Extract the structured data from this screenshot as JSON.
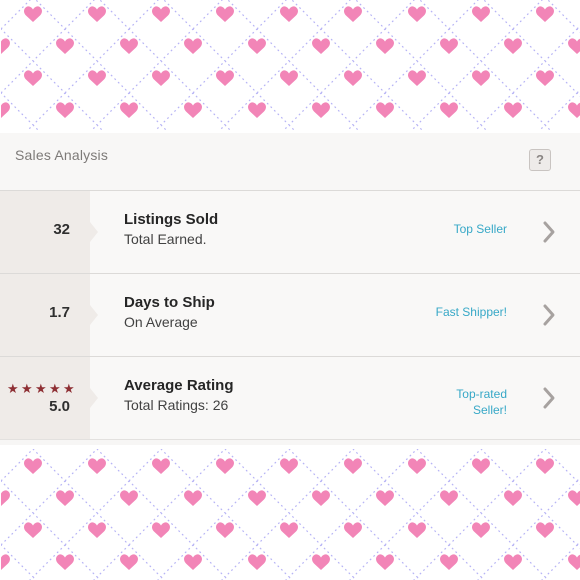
{
  "panel": {
    "title": "Sales Analysis",
    "help_label": "?"
  },
  "stats": [
    {
      "value": "32",
      "title": "Listings Sold",
      "subtitle": "Total Earned.",
      "badge": "Top Seller"
    },
    {
      "value": "1.7",
      "title": "Days to Ship",
      "subtitle": "On Average",
      "badge": "Fast Shipper!"
    },
    {
      "value": "5.0",
      "title": "Average Rating",
      "subtitle": "Total Ratings: 26",
      "badge_line1": "Top-rated",
      "badge_line2": "Seller!",
      "star_count": 5
    }
  ],
  "colors": {
    "heart": "#f285b7",
    "dots": "#b7b4f5",
    "accent": "#37a8c7",
    "star": "#8e2f34"
  },
  "icons": {
    "help": "question-mark-icon",
    "chevron": "chevron-right-icon",
    "heart": "heart-icon",
    "star": "star-icon"
  }
}
